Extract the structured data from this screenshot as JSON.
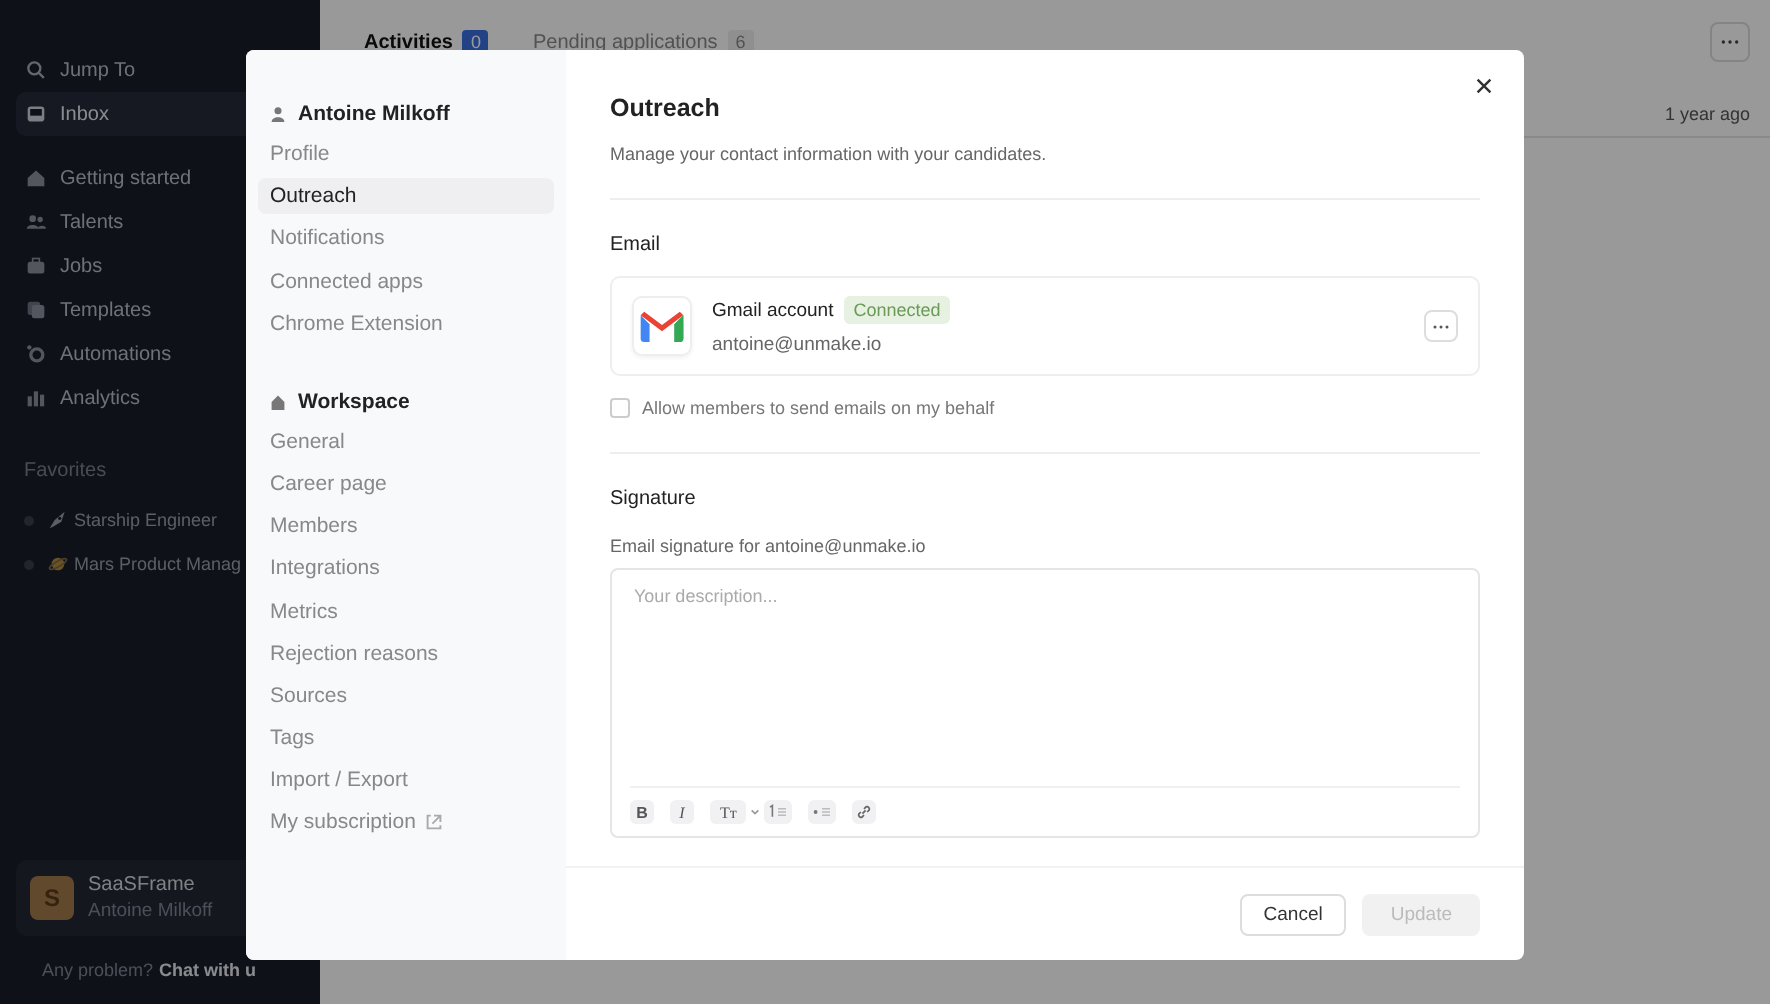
{
  "sidebar": {
    "search_label": "Jump To",
    "items": [
      {
        "label": "Inbox",
        "selected": true
      },
      {
        "label": "Getting started",
        "selected": false
      },
      {
        "label": "Talents",
        "selected": false
      },
      {
        "label": "Jobs",
        "selected": false
      },
      {
        "label": "Templates",
        "selected": false
      },
      {
        "label": "Automations",
        "selected": false
      },
      {
        "label": "Analytics",
        "selected": false
      }
    ],
    "favorites_title": "Favorites",
    "favorites": [
      {
        "label": "Starship Engineer"
      },
      {
        "label": "Mars Product Manag"
      }
    ],
    "workspace": {
      "initial": "S",
      "name": "SaaSFrame",
      "user": "Antoine Milkoff"
    },
    "help": {
      "text": "Any problem?",
      "link": "Chat with u"
    }
  },
  "main": {
    "tabs": [
      {
        "label": "Activities",
        "count": "0",
        "selected": true
      },
      {
        "label": "Pending applications",
        "count": "6",
        "selected": false
      }
    ],
    "rows": [
      {
        "time": "1 year ago"
      }
    ]
  },
  "modal": {
    "nav": [
      {
        "title": "Antoine Milkoff",
        "kind": "user",
        "items": [
          {
            "label": "Profile",
            "selected": false
          },
          {
            "label": "Outreach",
            "selected": true
          },
          {
            "label": "Notifications",
            "selected": false
          },
          {
            "label": "Connected apps",
            "selected": false
          },
          {
            "label": "Chrome Extension",
            "selected": false
          }
        ]
      },
      {
        "title": "Workspace",
        "kind": "workspace",
        "items": [
          {
            "label": "General",
            "selected": false
          },
          {
            "label": "Career page",
            "selected": false
          },
          {
            "label": "Members",
            "selected": false
          },
          {
            "label": "Integrations",
            "selected": false
          },
          {
            "label": "Metrics",
            "selected": false
          },
          {
            "label": "Rejection reasons",
            "selected": false
          },
          {
            "label": "Sources",
            "selected": false
          },
          {
            "label": "Tags",
            "selected": false
          },
          {
            "label": "Import / Export",
            "selected": false
          },
          {
            "label": "My subscription",
            "selected": false,
            "external": true
          }
        ]
      }
    ],
    "title": "Outreach",
    "subtitle": "Manage your contact information with your candidates.",
    "email": {
      "heading": "Email",
      "account": {
        "name": "Gmail account",
        "status": "Connected",
        "address": "antoine@unmake.io"
      },
      "allow_members": {
        "label": "Allow members to send emails on my behalf",
        "checked": false
      }
    },
    "signature": {
      "heading": "Signature",
      "label": "Email signature for antoine@unmake.io",
      "placeholder": "Your description...",
      "toolbar": [
        {
          "kind": "bold",
          "label": "B"
        },
        {
          "kind": "italic",
          "label": "I"
        },
        {
          "kind": "heading",
          "label": "Tт"
        },
        {
          "kind": "ordered"
        },
        {
          "kind": "bullet"
        },
        {
          "kind": "link"
        }
      ]
    },
    "buttons": [
      {
        "label": "Cancel",
        "disabled": false
      },
      {
        "label": "Update",
        "disabled": true
      }
    ]
  }
}
